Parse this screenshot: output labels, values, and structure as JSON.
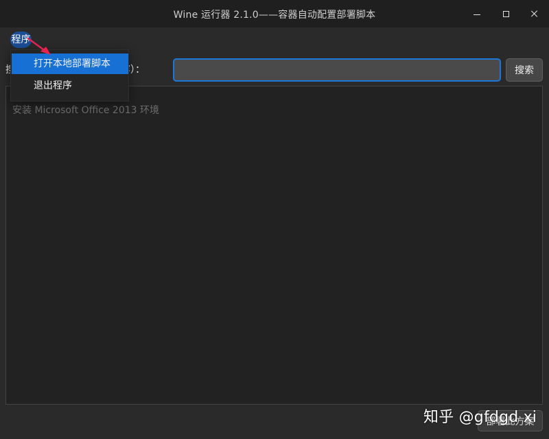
{
  "window": {
    "title": "Wine 运行器 2.1.0——容器自动配置部署脚本",
    "icons": {
      "minimize": "minimize-icon",
      "maximize": "maximize-icon",
      "close": "close-icon"
    }
  },
  "menubar": {
    "program_label": "程序",
    "menu": {
      "items": [
        {
          "label": "打开本地部署脚本",
          "selected": true
        },
        {
          "label": "退出程序",
          "selected": false
        }
      ]
    }
  },
  "search": {
    "label": "搜索内容（可以搜索名称内容）：",
    "value": "",
    "button_label": "搜索"
  },
  "results": {
    "items": [
      {
        "label": "安装 Microsoft Office 2013 环境"
      }
    ]
  },
  "actions": {
    "deploy_label": "部署此方案"
  },
  "watermark": {
    "text": "知乎 @gfdgd xi"
  },
  "colors": {
    "accent": "#1770d4",
    "focus_border": "#1e76d6",
    "annotation_arrow": "#e6224f",
    "background": "#2a2a2a"
  }
}
